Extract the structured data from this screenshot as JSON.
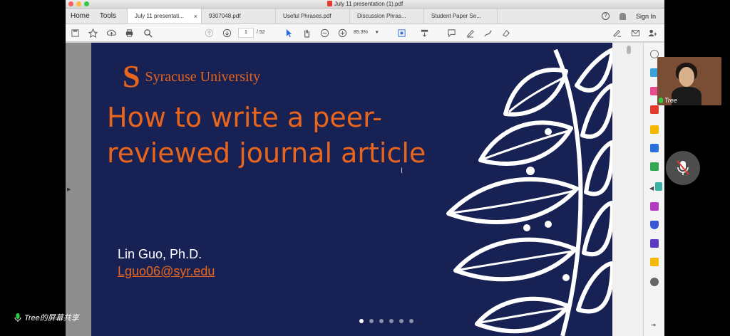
{
  "window": {
    "title": "July 11 presentation (1).pdf"
  },
  "nav": {
    "home": "Home",
    "tools": "Tools"
  },
  "tabs": [
    {
      "label": "July 11 presentati...",
      "active": true
    },
    {
      "label": "9307048.pdf"
    },
    {
      "label": "Useful Phrases.pdf"
    },
    {
      "label": "Discussion Phras..."
    },
    {
      "label": "Student Paper Se..."
    }
  ],
  "tab_close": "×",
  "help_glyph": "?",
  "sign_in": "Sign In",
  "toolbar": {
    "page_current": "1",
    "page_total": "/ 52",
    "zoom": "85.3%"
  },
  "slide": {
    "logo_mark": "S",
    "logo_text": "Syracuse University",
    "title": "How to write a peer-reviewed journal article",
    "author": "Lin Guo, Ph.D.",
    "email": "Lguo06@syr.edu",
    "dots": 6,
    "active_dot": 0
  },
  "video": {
    "participant": "Tree"
  },
  "screen_share": {
    "label": "Tree的屏幕共享"
  },
  "colors": {
    "slide_bg": "#182153",
    "brand_orange": "#e8651d",
    "accent_red": "#e23a2e"
  }
}
